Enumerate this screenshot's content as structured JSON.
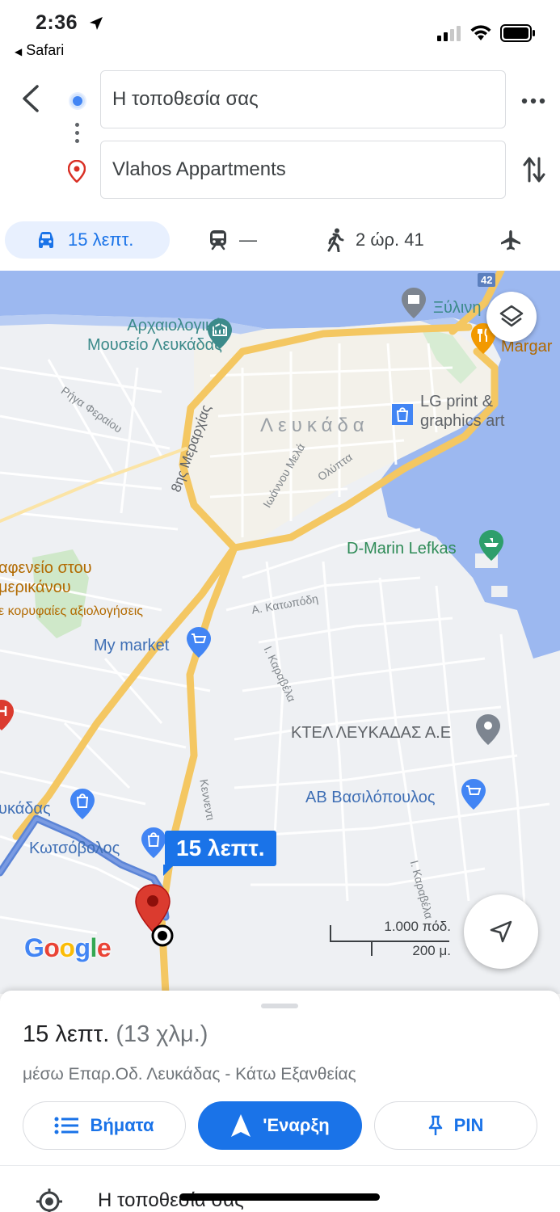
{
  "status_bar": {
    "time": "2:36",
    "back_app": "Safari"
  },
  "route": {
    "origin_value": "Η τοποθεσία σας",
    "destination_value": "Vlahos Appartments"
  },
  "modes": {
    "car": "15 λεπτ.",
    "transit": "—",
    "walk": "2 ώρ. 41"
  },
  "map": {
    "road_number": "42",
    "labels": {
      "museum": "Αρχαιολογικό\nΜουσείο Λευκάδας",
      "xylino": "Ξύλινη",
      "margar": "Margar",
      "lg_print": "LG print &\ngraphics art",
      "town": "Λευκάδα",
      "meraxias": "8ης Μεραρχίας",
      "riga": "Ρήγα Φεραίου",
      "ioannou": "Ιωάννου Μελά",
      "olympia": "Ολύπτα",
      "dmarin": "D-Marin Lefkas",
      "kafeneio": "αφενείο στου\nμερικάνου",
      "kafeneio_sub": "ε κορυφαίες αξιολογήσεις",
      "katopodi": "Α. Κατωπόδη",
      "my_market": "My market",
      "karavela1": "Ι. Καραβέλα",
      "ktel": "ΚΤΕΛ ΛΕΥΚΑΔΑΣ Α.Ε",
      "kennenti": "Κεννεντι",
      "ab": "ΑΒ Βασιλόπουλος",
      "leukadas": "υκάδας",
      "kotsovolos": "Κωτσόβολος",
      "karavela2": "Ι. Καραβέλα"
    },
    "route_badge": "15 λεπτ.",
    "scale_top": "1.000 πόδ.",
    "scale_bottom": "200 μ.",
    "google": [
      "G",
      "o",
      "o",
      "g",
      "l",
      "e"
    ]
  },
  "sheet": {
    "duration": "15 λεπτ.",
    "distance": "(13 χλμ.)",
    "via": "μέσω Επαρ.Οδ. Λευκάδας - Κάτω Εξανθείας",
    "steps_label": "Βήματα",
    "start_label": "'Εναρξη",
    "pin_label": "PIN",
    "first_step": "Η τοποθεσία σας"
  },
  "colors": {
    "accent": "#1a73e8",
    "water": "#9cb8f0",
    "road_major": "#f4c762",
    "route": "#5b84d6",
    "pin_red": "#db3b2f"
  },
  "icons": [
    "location-arrow-icon",
    "back-chevron-icon",
    "more-icon",
    "swap-icon",
    "car-icon",
    "transit-icon",
    "walk-icon",
    "flight-icon",
    "layers-icon",
    "recenter-icon",
    "list-icon",
    "navigation-arrow-icon",
    "pin-icon",
    "my-location-icon"
  ]
}
